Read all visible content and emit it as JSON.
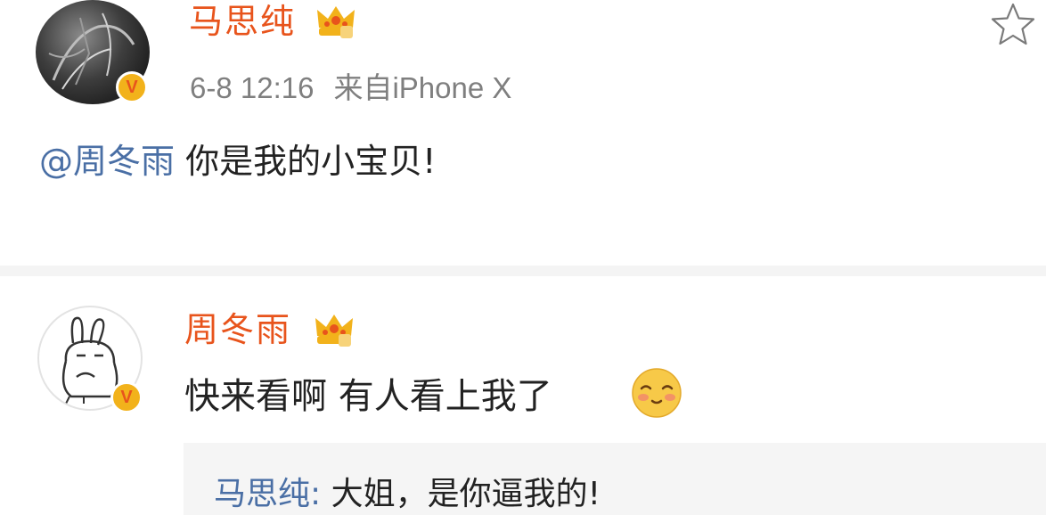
{
  "post": {
    "author": "马思纯",
    "time": "6-8 12:16",
    "source": "来自iPhone X",
    "mention": "@周冬雨",
    "text": "你是我的小宝贝!",
    "verified_badge": "V",
    "crown_icon": "crown-icon",
    "star_icon": "star-outline-icon"
  },
  "comment": {
    "author": "周冬雨",
    "text": "快来看啊 有人看上我了",
    "emoji": "shy-face-emoji",
    "verified_badge": "V",
    "crown_icon": "crown-icon",
    "reply": {
      "author": "马思纯:",
      "text": "大姐，是你逼我的!"
    }
  },
  "colors": {
    "name": "#e8541c",
    "link": "#4a6fa5",
    "meta": "#7f7f7f",
    "badge": "#f2b21b"
  }
}
